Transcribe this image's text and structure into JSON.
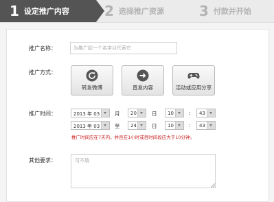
{
  "steps": [
    {
      "num": "1",
      "label": "设定推广内容"
    },
    {
      "num": "2",
      "label": "选择推广资源"
    },
    {
      "num": "3",
      "label": "付款并开始"
    }
  ],
  "form": {
    "name_label": "推广名称：",
    "name_placeholder": "为推广起一个名字以代表它",
    "method_label": "推广方式：",
    "methods": [
      {
        "label": "转发微博",
        "icon": "refresh-icon"
      },
      {
        "label": "直发内容",
        "icon": "arrow-right-icon"
      },
      {
        "label": "活动或应用分享",
        "icon": "gamepad-icon"
      }
    ],
    "time_label": "推广时间：",
    "start": {
      "year": "2013 年 03",
      "day": "20",
      "hour": "10",
      "minute": "43"
    },
    "end": {
      "year": "2013 年 03",
      "day": "24",
      "hour": "10",
      "minute": "43"
    },
    "units": {
      "month": "月",
      "to": "至",
      "day": "日",
      "colon": ":"
    },
    "warning": "推广时间应在7天内，并且在1小时或目时间段应大于10分钟。",
    "other_label": "其他要求：",
    "other_placeholder": "可不填"
  },
  "colors": {
    "accent": "#545454",
    "warning": "#c81a1a"
  }
}
